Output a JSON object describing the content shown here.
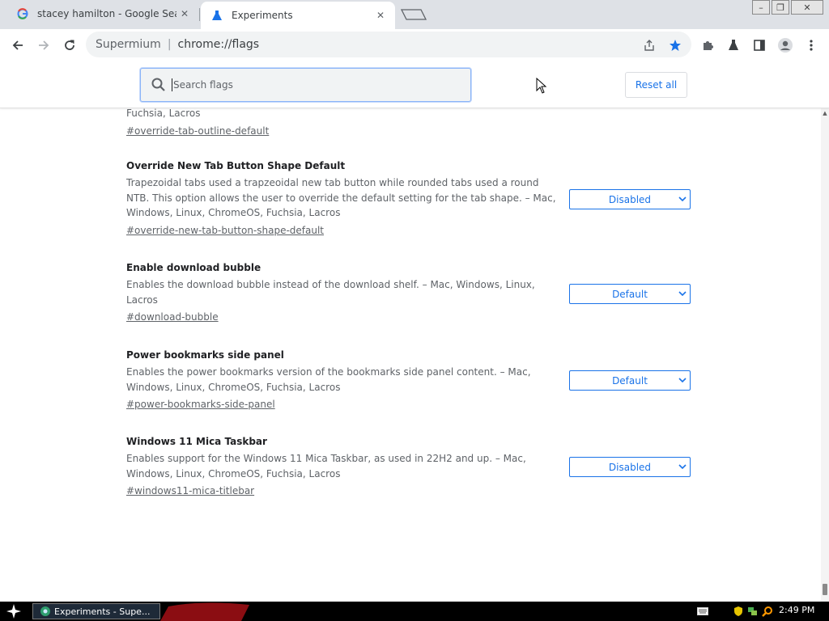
{
  "tabs": [
    {
      "title": "stacey hamilton - Google Search",
      "active": false,
      "favicon": "google-g-icon"
    },
    {
      "title": "Experiments",
      "active": true,
      "favicon": "flask-icon"
    }
  ],
  "omnibox": {
    "site": "Supermium",
    "url": "chrome://flags"
  },
  "flags_header": {
    "search_placeholder": "Search flags",
    "reset_label": "Reset all"
  },
  "experiments": [
    {
      "title": "",
      "desc": "Fuchsia, Lacros",
      "link": "#override-tab-outline-default",
      "value": ""
    },
    {
      "title": "Override New Tab Button Shape Default",
      "desc": "Trapezoidal tabs used a trapzeoidal new tab button while rounded tabs used a round NTB. This option allows the user to override the default setting for the tab shape. – Mac, Windows, Linux, ChromeOS, Fuchsia, Lacros",
      "link": "#override-new-tab-button-shape-default",
      "value": "Disabled"
    },
    {
      "title": "Enable download bubble",
      "desc": "Enables the download bubble instead of the download shelf. – Mac, Windows, Linux, Lacros",
      "link": "#download-bubble",
      "value": "Default"
    },
    {
      "title": "Power bookmarks side panel",
      "desc": "Enables the power bookmarks version of the bookmarks side panel content. – Mac, Windows, Linux, ChromeOS, Fuchsia, Lacros",
      "link": "#power-bookmarks-side-panel",
      "value": "Default"
    },
    {
      "title": "Windows 11 Mica Taskbar",
      "desc": "Enables support for the Windows 11 Mica Taskbar, as used in 22H2 and up. – Mac, Windows, Linux, ChromeOS, Fuchsia, Lacros",
      "link": "#windows11-mica-titlebar",
      "value": "Disabled"
    }
  ],
  "taskbar": {
    "task_label": "Experiments - Supe...",
    "clock": "2:49 PM"
  },
  "colors": {
    "accent": "#1a73e8",
    "tab_strip": "#dee1e6",
    "omnibox": "#f1f3f4",
    "taskbar": "#000000"
  }
}
